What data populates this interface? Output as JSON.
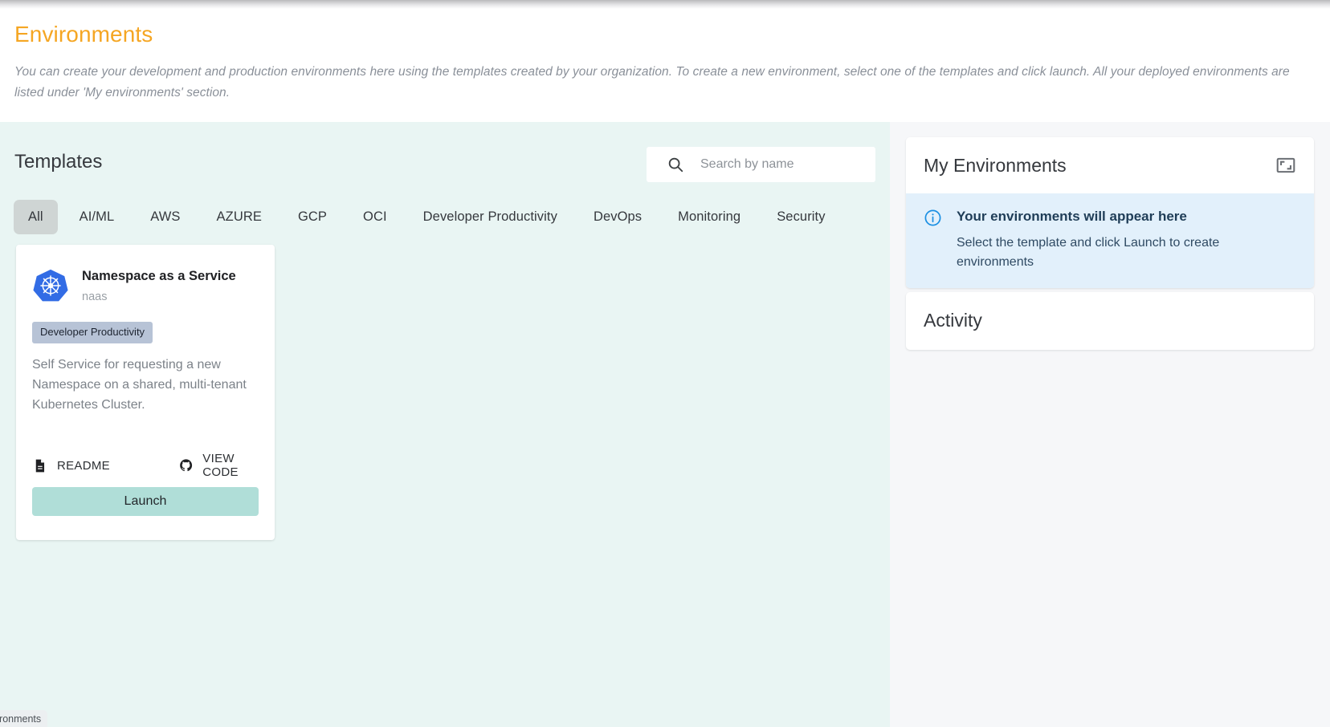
{
  "header": {
    "title": "Environments",
    "description": "You can create your development and production environments here using the templates created by your organization. To create a new environment, select one of the templates and click launch. All your deployed environments are listed under 'My environments' section.",
    "title_color": "#f5a623"
  },
  "templates": {
    "heading": "Templates",
    "search": {
      "placeholder": "Search by name",
      "value": "",
      "icon": "search-icon"
    },
    "tabs": [
      {
        "label": "All",
        "active": true
      },
      {
        "label": "AI/ML",
        "active": false
      },
      {
        "label": "AWS",
        "active": false
      },
      {
        "label": "AZURE",
        "active": false
      },
      {
        "label": "GCP",
        "active": false
      },
      {
        "label": "OCI",
        "active": false
      },
      {
        "label": "Developer Productivity",
        "active": false
      },
      {
        "label": "DevOps",
        "active": false
      },
      {
        "label": "Monitoring",
        "active": false
      },
      {
        "label": "Security",
        "active": false
      }
    ],
    "cards": [
      {
        "icon": "kubernetes-icon",
        "title": "Namespace as a Service",
        "subtitle": "naas",
        "chip": "Developer Productivity",
        "description": "Self Service for requesting a new Namespace on a shared, multi-tenant Kubernetes Cluster.",
        "readme_label": "README",
        "readme_icon": "document-icon",
        "view_code_label": "VIEW CODE",
        "view_code_icon": "github-icon",
        "launch_label": "Launch",
        "launch_color": "#b0ded8"
      }
    ]
  },
  "my_environments": {
    "title": "My Environments",
    "expand_icon": "fullscreen-expand-icon",
    "empty_state": {
      "icon": "info-circle-icon",
      "title": "Your environments will appear here",
      "subtitle": "Select the template and click Launch to create environments",
      "background": "#e2f0fb",
      "icon_color": "#1a8fe3"
    }
  },
  "activity": {
    "title": "Activity"
  },
  "status_bar": {
    "text": "vironments"
  }
}
